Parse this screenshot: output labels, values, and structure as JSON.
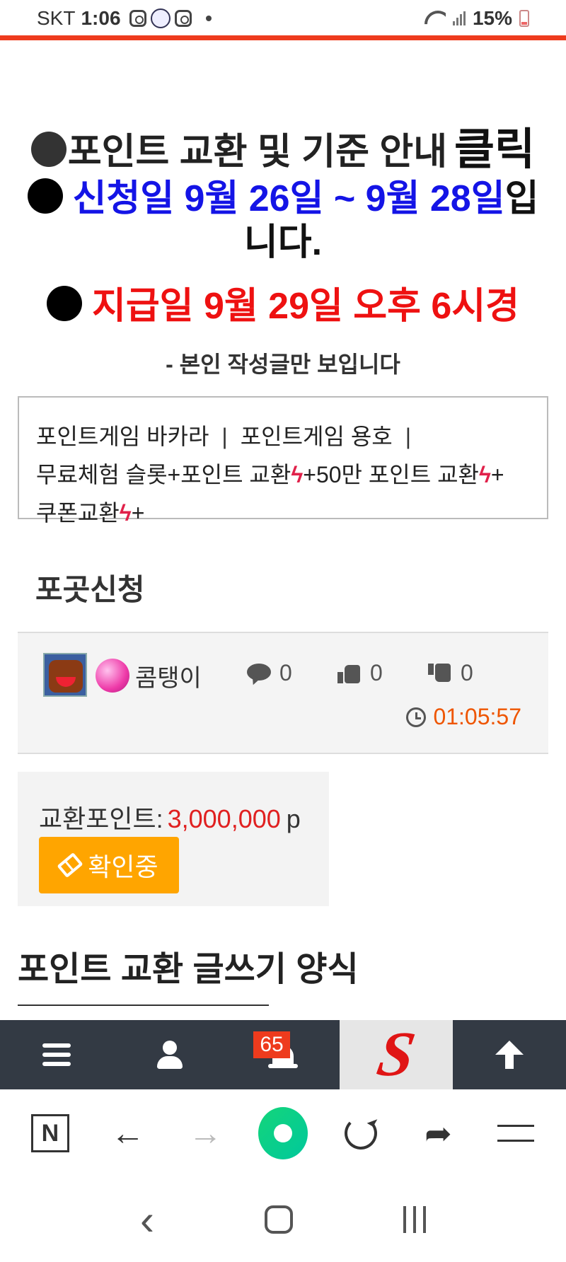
{
  "status_bar": {
    "carrier": "SKT",
    "time": "1:06",
    "battery": "15%"
  },
  "notices": {
    "line1_text": "포인트 교환 및 기준 안내",
    "line1_click": "클릭",
    "line2_blue": "신청일 9월 26일 ~ 9월 28일",
    "line2_rest": "입니다.",
    "line3": "지급일 9월 29일 오후 6시경",
    "line4": "- 본인 작성글만 보입니다"
  },
  "links": {
    "baccarat": "포인트게임 바카라",
    "dragon_tiger": "포인트게임 용호",
    "free_slot": "무료체험 슬롯+포인트 교환",
    "exchange_500k": "+50만 포인트 교환",
    "coupon": "쿠폰교환",
    "plus": "+",
    "separator": "|"
  },
  "section_title": "포곳신청",
  "post": {
    "nickname": "콤탱이",
    "comments": "0",
    "likes": "0",
    "dislikes": "0",
    "time": "01:05:57"
  },
  "exchange": {
    "label": "교환포인트:",
    "value": "3,000,000",
    "unit": "p",
    "status_button": "확인중"
  },
  "form_title": "포인트 교환 글쓰기 양식",
  "site_nav": {
    "notification_count": "65",
    "logo_letter": "S"
  },
  "browser": {
    "n_label": "N"
  },
  "colors": {
    "accent_red": "#ee3b1d",
    "notice_blue": "#1414e6",
    "notice_red": "#ee1111",
    "status_orange": "#ffa500",
    "nav_dark": "#333a44"
  }
}
